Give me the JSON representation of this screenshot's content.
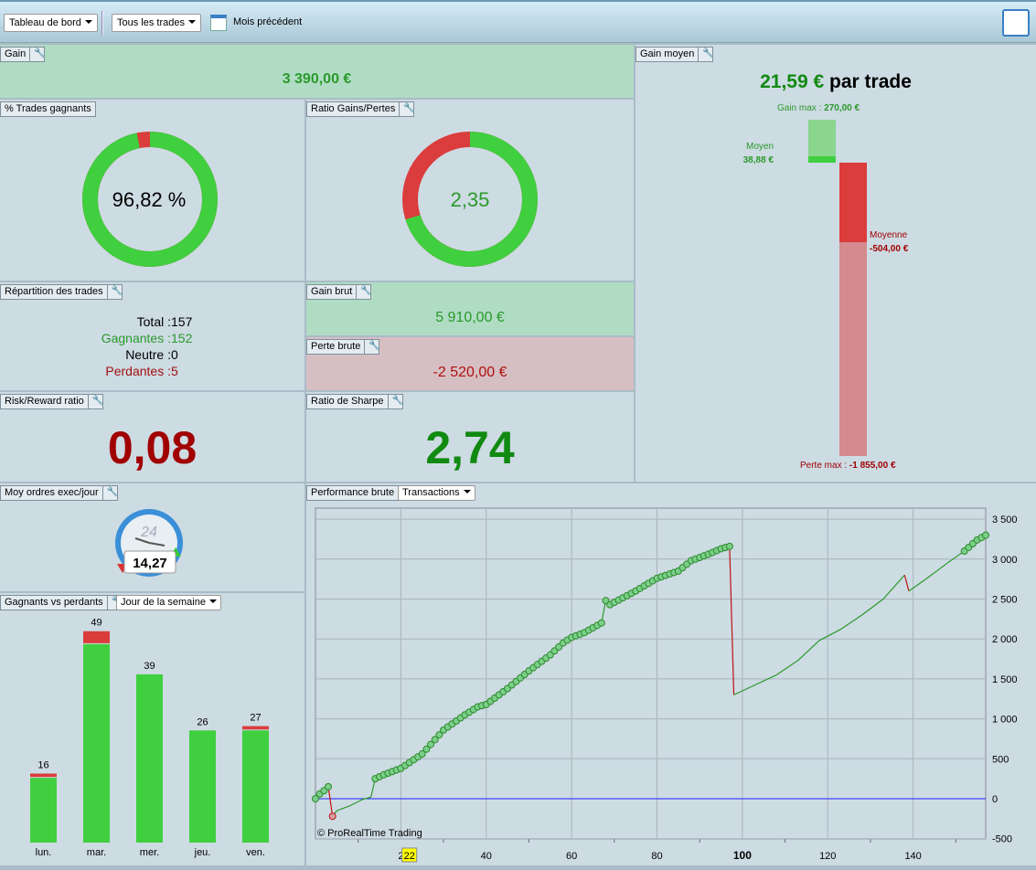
{
  "toolbar": {
    "dashboard": "Tableau de bord",
    "trades_filter": "Tous les trades",
    "period": "Mois précédent",
    "calendar_icon": "calendar-icon",
    "report_icon": "report-icon"
  },
  "gain": {
    "title": "Gain",
    "value": "3 390,00 €"
  },
  "win_pct": {
    "title": "% Trades gagnants",
    "value": "96,82 %",
    "fraction": 0.9682,
    "colors": {
      "win": "#3fcf3f",
      "loss": "#db3c3c"
    }
  },
  "ratio": {
    "title": "Ratio Gains/Pertes",
    "value": "2,35",
    "gain_share": 0.701
  },
  "repartition": {
    "title": "Répartition des trades",
    "rows": [
      {
        "label": "Total : ",
        "value": "157",
        "color": "#000"
      },
      {
        "label": "Gagnantes : ",
        "value": "152",
        "color": "#2a9a2a"
      },
      {
        "label": "Neutre : ",
        "value": "0",
        "color": "#000"
      },
      {
        "label": "Perdantes : ",
        "value": "5",
        "color": "#a01010"
      }
    ]
  },
  "gain_brut": {
    "title": "Gain brut",
    "value": "5 910,00 €"
  },
  "perte_brute": {
    "title": "Perte brute",
    "value": "-2 520,00 €"
  },
  "rr": {
    "title": "Risk/Reward ratio",
    "value": "0,08"
  },
  "sharpe": {
    "title": "Ratio de Sharpe",
    "value": "2,74"
  },
  "gain_moyen": {
    "title": "Gain moyen",
    "value": "21,59 €",
    "suffix": " par trade",
    "gain_max_label": "Gain max : ",
    "gain_max": "270,00 €",
    "moyen_label": "Moyen",
    "moyen": "38,88 €",
    "moyenne_label": "Moyenne",
    "moyenne": "-504,00 €",
    "perte_max_label": "Perte max : ",
    "perte_max": "-1 855,00 €",
    "values": {
      "gain_max": 270,
      "avg_gain": 38.88,
      "avg_loss": -504,
      "loss_max": -1855
    }
  },
  "orders": {
    "title": "Moy ordres exec/jour",
    "value": "14,27",
    "dial": "24"
  },
  "chart_data": [
    {
      "type": "bar",
      "title": "Gagnants vs perdants",
      "selector": "Jour de la semaine",
      "categories": [
        "lun.",
        "mar.",
        "mer.",
        "jeu.",
        "ven."
      ],
      "series": [
        {
          "name": "Gagnants",
          "values": [
            15,
            46,
            39,
            26,
            26
          ],
          "color": "#3fcf3f"
        },
        {
          "name": "Perdants",
          "values": [
            1,
            3,
            0,
            0,
            1
          ],
          "color": "#db3c3c"
        }
      ],
      "totals": [
        "16",
        "49",
        "39",
        "26",
        "27"
      ]
    },
    {
      "type": "line",
      "title": "Performance brute",
      "selector": "Transactions",
      "xlim": [
        0,
        157
      ],
      "ylim": [
        -500,
        3500
      ],
      "yticks": [
        "3 500",
        "3 000",
        "2 500",
        "2 000",
        "1 500",
        "1 000",
        "500",
        "0",
        "-500"
      ],
      "ytick_values": [
        3500,
        3000,
        2500,
        2000,
        1500,
        1000,
        500,
        0,
        -500
      ],
      "xticks": [
        "2",
        "40",
        "60",
        "80",
        "100",
        "120",
        "140"
      ],
      "xtick_values": [
        20,
        40,
        60,
        80,
        100,
        120,
        140
      ],
      "highlight_x": "22",
      "grid": true,
      "watermark": "© ProRealTime Trading",
      "points": [
        [
          0,
          0
        ],
        [
          1,
          60
        ],
        [
          2,
          100
        ],
        [
          3,
          150
        ],
        [
          4,
          -220
        ],
        [
          5,
          -150
        ],
        [
          8,
          -90
        ],
        [
          11,
          -10
        ],
        [
          13,
          20
        ],
        [
          14,
          250
        ],
        [
          16,
          300
        ],
        [
          20,
          380
        ],
        [
          25,
          560
        ],
        [
          30,
          860
        ],
        [
          35,
          1050
        ],
        [
          38,
          1150
        ],
        [
          40,
          1180
        ],
        [
          45,
          1380
        ],
        [
          50,
          1600
        ],
        [
          55,
          1800
        ],
        [
          58,
          1950
        ],
        [
          60,
          2020
        ],
        [
          63,
          2080
        ],
        [
          67,
          2200
        ],
        [
          68,
          2480
        ],
        [
          69,
          2430
        ],
        [
          75,
          2600
        ],
        [
          80,
          2760
        ],
        [
          85,
          2850
        ],
        [
          88,
          2980
        ],
        [
          92,
          3060
        ],
        [
          95,
          3130
        ],
        [
          97,
          3160
        ],
        [
          98,
          1300
        ],
        [
          102,
          1400
        ],
        [
          108,
          1550
        ],
        [
          113,
          1730
        ],
        [
          118,
          1980
        ],
        [
          123,
          2120
        ],
        [
          128,
          2300
        ],
        [
          133,
          2500
        ],
        [
          138,
          2800
        ],
        [
          139,
          2600
        ],
        [
          143,
          2750
        ],
        [
          148,
          2950
        ],
        [
          152,
          3100
        ],
        [
          155,
          3240
        ],
        [
          157,
          3300
        ]
      ],
      "marker_ranges": [
        [
          0,
          4
        ],
        [
          14,
          97
        ],
        [
          152,
          157
        ]
      ],
      "colors": {
        "line": "#2a9a2a",
        "drop": "#c01010",
        "zero": "#2020ff"
      }
    }
  ]
}
